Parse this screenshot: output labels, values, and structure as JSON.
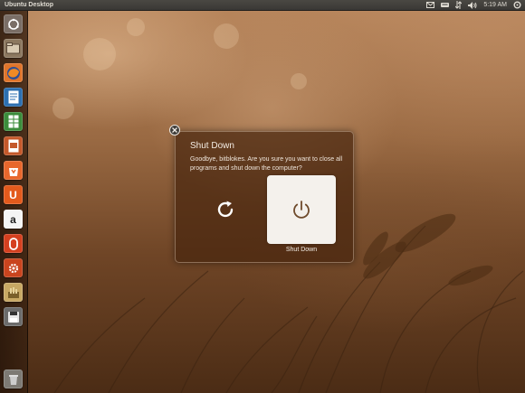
{
  "panel": {
    "title": "Ubuntu Desktop",
    "clock": "5:19 AM",
    "indicators": [
      "mail-icon",
      "keyboard-icon",
      "network-icon",
      "volume-icon",
      "clock",
      "power-gear-icon"
    ]
  },
  "launcher": {
    "items": [
      {
        "name": "dash-home-icon",
        "color": "#7a6e66"
      },
      {
        "name": "files-icon",
        "color": "#8c7860"
      },
      {
        "name": "firefox-icon",
        "color": "#e0752b"
      },
      {
        "name": "libreoffice-writer-icon",
        "color": "#2c6fb0"
      },
      {
        "name": "libreoffice-calc-icon",
        "color": "#3b8c3b"
      },
      {
        "name": "libreoffice-impress-icon",
        "color": "#c4582a"
      },
      {
        "name": "software-center-icon",
        "color": "#e8672c"
      },
      {
        "name": "ubuntu-one-icon",
        "color": "#e35a1c"
      },
      {
        "name": "amazon-icon",
        "color": "#2b2b2b"
      },
      {
        "name": "ubuntu-one-music-icon",
        "color": "#d5401f"
      },
      {
        "name": "system-settings-icon",
        "color": "#c9441e"
      },
      {
        "name": "workspaces-icon",
        "color": "#c8a864"
      },
      {
        "name": "floppy-disk-icon",
        "color": "#6b6b6b"
      },
      {
        "name": "trash-icon",
        "color": "#7d7a74"
      }
    ]
  },
  "dialog": {
    "title": "Shut Down",
    "message": "Goodbye, bitblokes. Are you sure you want to close all programs and shut down the computer?",
    "actions": [
      {
        "name": "restart",
        "icon": "restart-icon",
        "label": ""
      },
      {
        "name": "shutdown",
        "icon": "power-icon",
        "label": "Shut Down",
        "selected": true
      }
    ]
  },
  "colors": {
    "dialog_bg": "#48260e",
    "selected_tile": "#f4f1ec",
    "panel": "#3c3b37"
  }
}
